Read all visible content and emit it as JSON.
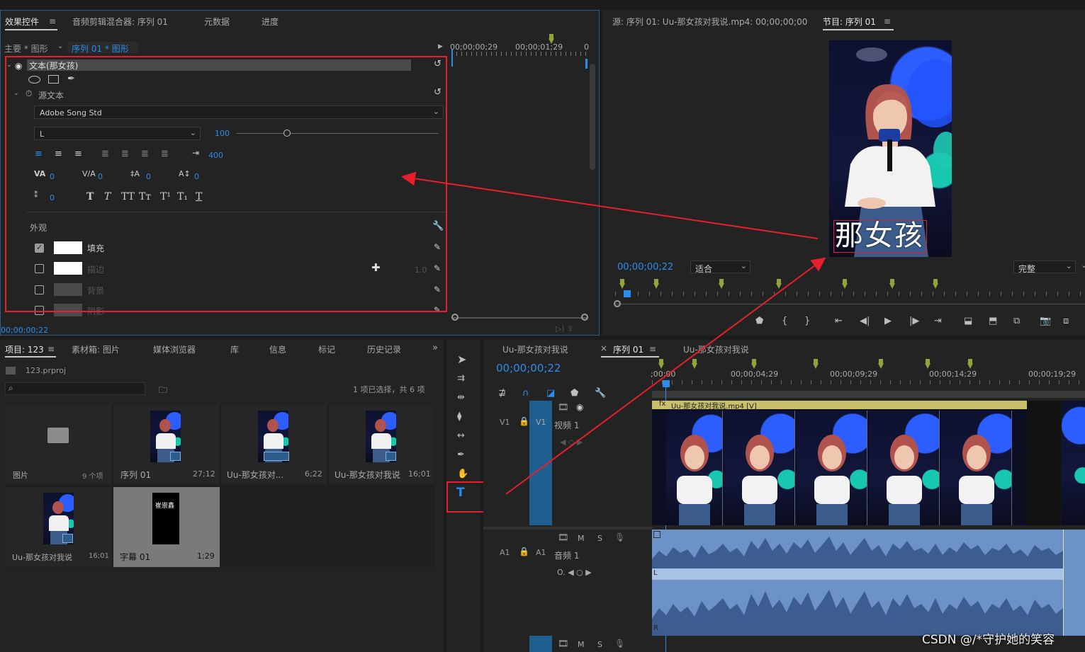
{
  "effect_controls": {
    "tabs": [
      "效果控件",
      "音频剪辑混合器: 序列 01",
      "元数据",
      "进度"
    ],
    "breadcrumb_main": "主要 * 图形",
    "breadcrumb_seq": "序列 01 * 图形",
    "timecodes": [
      "00;00;00;29",
      "00;00;01;29",
      "0"
    ],
    "layer_name": "文本(那女孩)",
    "source_text_label": "源文本",
    "font_family": "Adobe Song Std",
    "font_style": "L",
    "font_size": "100",
    "tracking_width": "400",
    "kerning_values": [
      "0",
      "0",
      "0",
      "0",
      "0"
    ],
    "text_style_buttons": [
      "T",
      "T",
      "TT",
      "Tт",
      "T¹",
      "T₁",
      "T"
    ],
    "appearance_label": "外观",
    "appearance": [
      {
        "label": "填充",
        "checked": true
      },
      {
        "label": "描边",
        "checked": false,
        "value": "1.0"
      },
      {
        "label": "背景",
        "checked": false
      },
      {
        "label": "阴影",
        "checked": false
      }
    ],
    "footer_timecode": "00;00;00;22"
  },
  "source_monitor": {
    "title": "源: 序列 01: Uu-那女孩对我说.mp4: 00;00;00;00",
    "program_tab": "节目: 序列 01",
    "overlay_text": "那女孩",
    "timecode": "00;00;00;22",
    "zoom": "适合",
    "quality": "完整"
  },
  "project_panel": {
    "tabs": [
      "项目: 123",
      "素材箱: 图片",
      "媒体浏览器",
      "库",
      "信息",
      "标记",
      "历史记录"
    ],
    "project_file": "123.prproj",
    "selection_info": "1 项已选择，共 6 项",
    "items": [
      {
        "name": "图片",
        "meta": "9 个项"
      },
      {
        "name": "序列 01",
        "meta": "27;12"
      },
      {
        "name": "Uu-那女孩对...",
        "meta": "6;22"
      },
      {
        "name": "Uu-那女孩对我说",
        "meta": "16;01"
      },
      {
        "name": "Uu-那女孩对我说",
        "meta": "16;01"
      },
      {
        "name": "字幕 01",
        "meta": "1;29",
        "thumb_text": "崔崇鑫"
      }
    ]
  },
  "timeline": {
    "tabs": [
      "Uu-那女孩对我说",
      "序列 01",
      "Uu-那女孩对我说"
    ],
    "timecode": "00;00;00;22",
    "ruler": [
      ";00;00",
      "00;00;04;29",
      "00;00;09;29",
      "00;00;14;29",
      "00;00;19;29"
    ],
    "tracks": {
      "v1_label": "V1",
      "v1_name": "视频 1",
      "a1_label": "A1",
      "a1_name": "音频 1",
      "m": "M",
      "s": "S"
    },
    "clip_label": "Uu-那女孩对我说.mp4 [V]",
    "fx_badge": "fx",
    "audio_channels": [
      "L",
      "R"
    ]
  },
  "watermark": "CSDN @/*守护她的笑容",
  "colors": {
    "accent_blue": "#2d8ceb",
    "highlight_red": "#e5202c",
    "marker_green": "#8fa43a",
    "clip_blue": "#1f5f8f",
    "audio_blue": "#6d92c7"
  }
}
